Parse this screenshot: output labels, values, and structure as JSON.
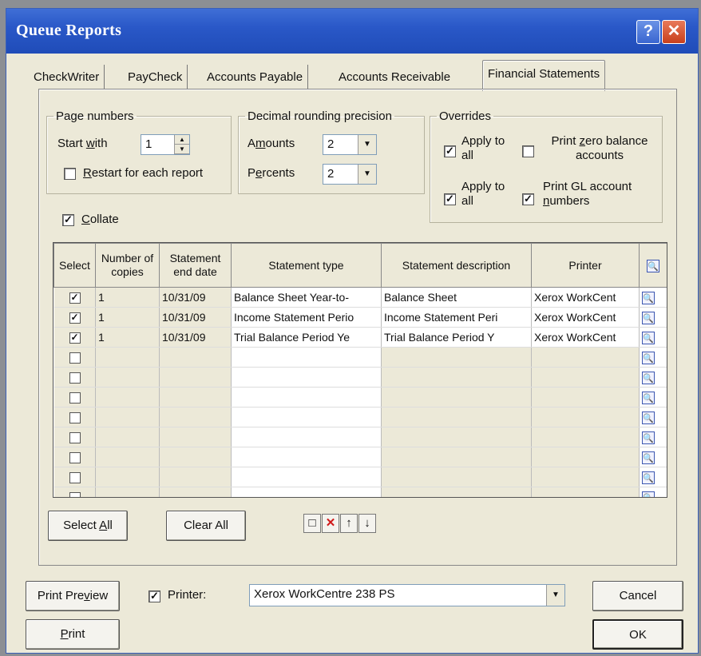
{
  "window": {
    "title": "Queue Reports",
    "help_label": "?",
    "close_label": "✕"
  },
  "tabs": [
    {
      "label": "CheckWriter"
    },
    {
      "label": "PayCheck"
    },
    {
      "label": "Accounts Payable"
    },
    {
      "label": "Accounts Receivable"
    },
    {
      "label": "Financial Statements",
      "active": true
    }
  ],
  "page_numbers": {
    "legend": "Page numbers",
    "start_with_label_pre": "Start ",
    "start_with_label_u": "w",
    "start_with_label_post": "ith",
    "start_with_value": "1",
    "restart_label_u": "R",
    "restart_label_post": "estart for each report",
    "restart_checked": false
  },
  "decimal": {
    "legend": "Decimal rounding precision",
    "amounts_pre": "A",
    "amounts_u": "m",
    "amounts_post": "ounts",
    "amounts_value": "2",
    "percents_pre": "P",
    "percents_u": "e",
    "percents_post": "rcents",
    "percents_value": "2"
  },
  "overrides": {
    "legend": "Overrides",
    "apply_label": "Apply to all",
    "apply1_checked": true,
    "apply2_checked": true,
    "zero_pre": "Print ",
    "zero_u": "z",
    "zero_post": "ero balance accounts",
    "zero_checked": false,
    "gl_line1": "Print GL account",
    "gl_u": "n",
    "gl_post": "umbers",
    "gl_checked": true
  },
  "collate": {
    "u": "C",
    "post": "ollate",
    "checked": true
  },
  "table": {
    "headers": {
      "select": "Select",
      "copies": "Number of copies",
      "end_date": "Statement end date",
      "type": "Statement type",
      "description": "Statement description",
      "printer": "Printer"
    },
    "rows": [
      {
        "checked": "✓",
        "copies": "1",
        "date": "10/31/09",
        "type": "Balance Sheet Year-to-",
        "desc": "Balance Sheet",
        "printer": "Xerox WorkCent"
      },
      {
        "checked": "✓",
        "copies": "1",
        "date": "10/31/09",
        "type": "Income Statement Perio",
        "desc": "Income Statement Peri",
        "printer": "Xerox WorkCent"
      },
      {
        "checked": "✓",
        "copies": "1",
        "date": "10/31/09",
        "type": "Trial Balance Period Ye",
        "desc": "Trial Balance Period Y",
        "printer": "Xerox WorkCent"
      }
    ]
  },
  "buttons": {
    "select_all_pre": "Select ",
    "select_all_u": "A",
    "select_all_post": "ll",
    "clear_all": "Clear All",
    "print_preview_pre": "Print Pre",
    "print_preview_u": "v",
    "print_preview_post": "iew",
    "print_u": "P",
    "print_post": "rint",
    "cancel": "Cancel",
    "ok": "OK"
  },
  "printer": {
    "label": "Printer:",
    "checked": true,
    "selected": "Xerox WorkCentre 238 PS"
  }
}
